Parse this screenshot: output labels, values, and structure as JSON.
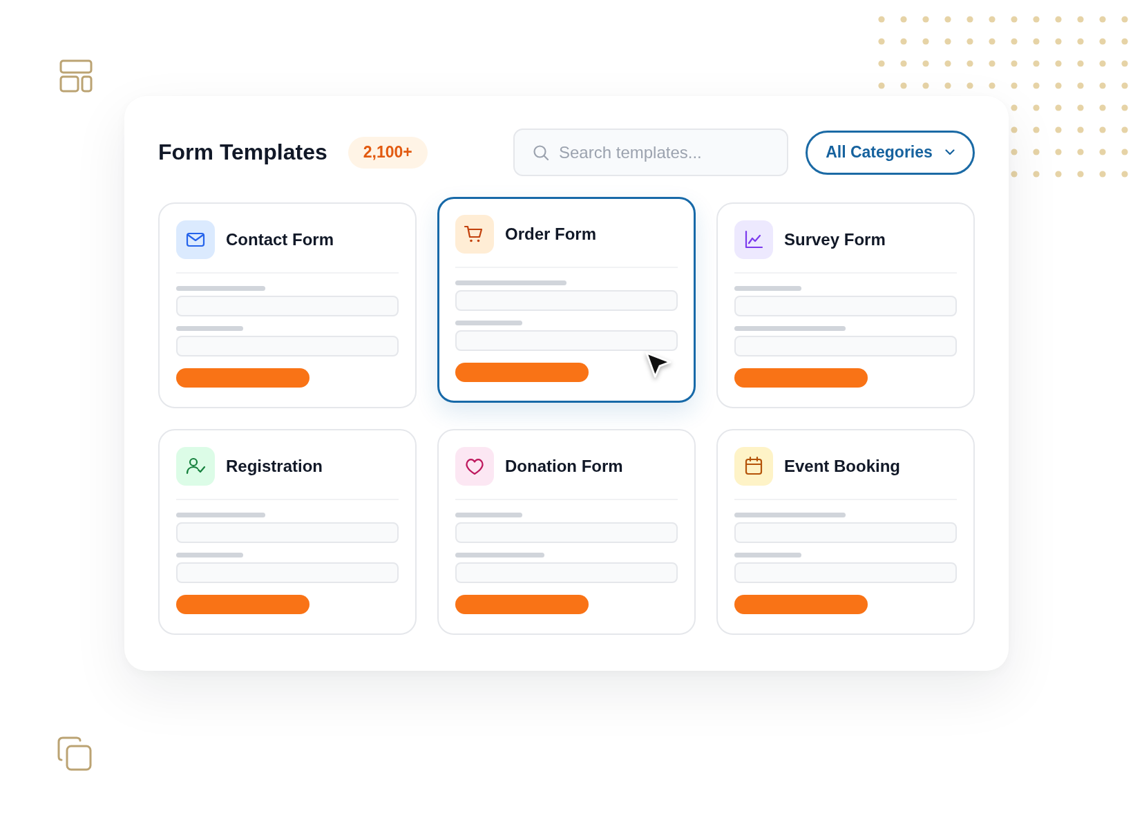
{
  "header": {
    "title": "Form Templates",
    "count_badge": "2,100+"
  },
  "search": {
    "placeholder": "Search templates..."
  },
  "category_filter": {
    "label": "All Categories"
  },
  "templates": [
    {
      "kind": "contact",
      "title": "Contact Form",
      "color": "#dbeafe",
      "selected": false
    },
    {
      "kind": "order",
      "title": "Order Form",
      "color": "#ffedd5",
      "selected": true
    },
    {
      "kind": "survey",
      "title": "Survey Form",
      "color": "#ede9fe",
      "selected": false
    },
    {
      "kind": "registration",
      "title": "Registration",
      "color": "#dcfce7",
      "selected": false
    },
    {
      "kind": "donation",
      "title": "Donation Form",
      "color": "#fce7f3",
      "selected": false
    },
    {
      "kind": "event",
      "title": "Event Booking",
      "color": "#fef3c7",
      "selected": false
    }
  ]
}
